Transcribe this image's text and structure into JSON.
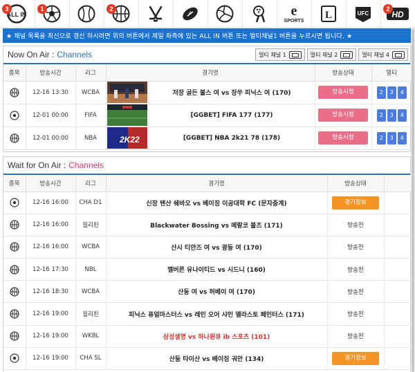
{
  "tabs": [
    {
      "icon": "all-in-icon",
      "badge": "3",
      "label": "ALL IN"
    },
    {
      "icon": "soccer-icon",
      "badge": "1"
    },
    {
      "icon": "baseball-icon",
      "badge": ""
    },
    {
      "icon": "basketball-icon",
      "badge": "2"
    },
    {
      "icon": "hockey-icon",
      "badge": ""
    },
    {
      "icon": "football-icon",
      "badge": ""
    },
    {
      "icon": "volleyball-icon",
      "badge": ""
    },
    {
      "icon": "bowling-icon",
      "badge": ""
    },
    {
      "icon": "esports-icon",
      "badge": "",
      "label": "SPORTS"
    },
    {
      "icon": "lol-icon",
      "badge": "",
      "label": "L"
    },
    {
      "icon": "ufc-icon",
      "badge": "",
      "label": "UFC"
    },
    {
      "icon": "hd-icon",
      "badge": "2",
      "label": "HD"
    }
  ],
  "notice": "★ 채널 목록을 최신으로 갱신 하시려면 위의 버튼에서 제일 좌측에 있는 ALL IN 버튼 또는 멀티채널1 버튼을 누르시면 됩니다. ★",
  "live": {
    "title": "Now On Air :",
    "title_accent": "Channels",
    "multi_buttons": [
      "멀티 채널 1",
      "멀티 채널 2",
      "멀티 채널 4"
    ],
    "headers": [
      "종목",
      "방송시간",
      "리그",
      "",
      "경기명",
      "방송상태",
      "멀티"
    ],
    "rows": [
      {
        "sport": "basketball-icon",
        "time": "12-16 13:30",
        "league": "WCBA",
        "thumb": "court",
        "game": "저장 골든 불스 여 vs 장쑤 피닉스 여 (170)",
        "status": "방송시청",
        "multi": [
          "2",
          "3",
          "4"
        ]
      },
      {
        "sport": "soccer-icon",
        "time": "12-01 00:00",
        "league": "FIFA",
        "thumb": "pitch",
        "game": "[GGBET] FIFA 177 (177)",
        "status": "방송시청",
        "multi": [
          "2",
          "3",
          "4"
        ]
      },
      {
        "sport": "basketball-icon",
        "time": "12-01 00:00",
        "league": "NBA",
        "thumb": "2k22",
        "game": "[GGBET] NBA 2k21 78 (178)",
        "status": "방송시청",
        "multi": [
          "2",
          "3",
          "4"
        ]
      }
    ]
  },
  "wait": {
    "title": "Wait for On Air :",
    "title_accent": "Channels",
    "headers": [
      "종목",
      "방송시간",
      "리그",
      "경기명",
      "방송상태"
    ],
    "rows": [
      {
        "sport": "soccer-icon",
        "time": "12-16 16:00",
        "league": "CHA D1",
        "game": "신장 텐산 쉐바오 vs 베이징 이공대학 FC (문자중계)",
        "status": "경기정보",
        "status_type": "button",
        "red": false
      },
      {
        "sport": "basketball-icon",
        "time": "12-16 16:00",
        "league": "필리핀",
        "game": "Blackwater Bossing vs 메랄코 볼츠 (171)",
        "status": "방송전",
        "status_type": "text",
        "red": false
      },
      {
        "sport": "basketball-icon",
        "time": "12-16 16:00",
        "league": "WCBA",
        "game": "산시 티안즈 여 vs 광둥 여 (170)",
        "status": "방송전",
        "status_type": "text",
        "red": false
      },
      {
        "sport": "basketball-icon",
        "time": "12-16 17:30",
        "league": "NBL",
        "game": "멜버른 유나이티드 vs 시드니 (160)",
        "status": "방송전",
        "status_type": "text",
        "red": false
      },
      {
        "sport": "basketball-icon",
        "time": "12-16 18:30",
        "league": "WCBA",
        "game": "산둥 여 vs 허베이 여 (170)",
        "status": "방송전",
        "status_type": "text",
        "red": false
      },
      {
        "sport": "basketball-icon",
        "time": "12-16 19:00",
        "league": "필리핀",
        "game": "피닉스 퓨얼마스터스 vs 레인 오어 샤인 엘라스토 페인터스 (171)",
        "status": "방송전",
        "status_type": "text",
        "red": false
      },
      {
        "sport": "basketball-icon",
        "time": "12-16 19:00",
        "league": "WKBL",
        "game": "삼성생명 vs 하나원큐 ib 스포츠 (101)",
        "status": "방송전",
        "status_type": "text",
        "red": true
      },
      {
        "sport": "soccer-icon",
        "time": "12-16 19:00",
        "league": "CHA SL",
        "game": "산둥 타이산 vs 베이징 궈안 (134)",
        "status": "경기정보",
        "status_type": "button",
        "red": false
      }
    ]
  }
}
